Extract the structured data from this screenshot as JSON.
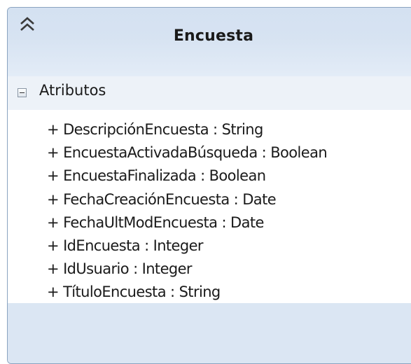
{
  "class": {
    "name": "Encuesta",
    "collapse_icon": "double-chevron-up-icon",
    "section": {
      "label": "Atributos",
      "expander_icon": "collapse-minus-icon"
    },
    "attributes": [
      "+ DescripciónEncuesta : String",
      "+ EncuestaActivadaBúsqueda : Boolean",
      "+ EncuestaFinalizada : Boolean",
      "+ FechaCreaciónEncuesta : Date",
      "+ FechaUltModEncuesta : Date",
      "+ IdEncuesta : Integer",
      "+ IdUsuario : Integer",
      "+ TítuloEncuesta : String"
    ]
  },
  "colors": {
    "header": "#d7e3f2",
    "border": "#8aa3c0",
    "footer": "#dbe6f3"
  }
}
